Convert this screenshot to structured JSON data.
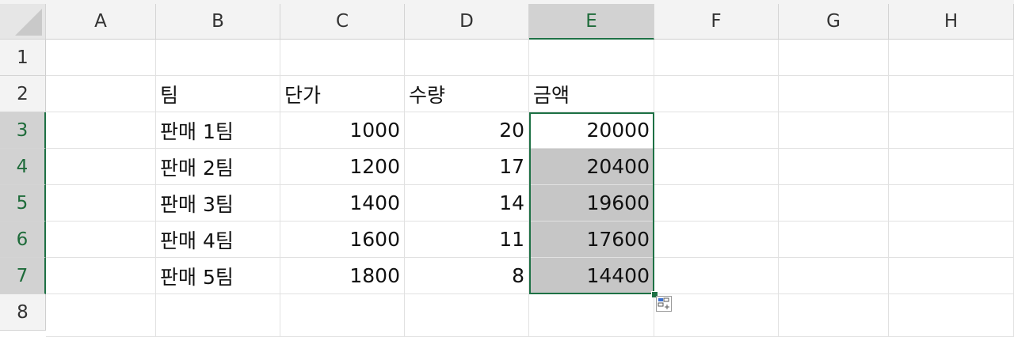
{
  "columns": [
    "A",
    "B",
    "C",
    "D",
    "E",
    "F",
    "G",
    "H"
  ],
  "rows": [
    "1",
    "2",
    "3",
    "4",
    "5",
    "6",
    "7",
    "8"
  ],
  "active_column": "E",
  "headers": {
    "team": "팀",
    "unit_price": "단가",
    "quantity": "수량",
    "amount": "금액"
  },
  "table": [
    {
      "team": "판매 1팀",
      "unit_price": "1000",
      "quantity": "20",
      "amount": "20000"
    },
    {
      "team": "판매 2팀",
      "unit_price": "1200",
      "quantity": "17",
      "amount": "20400"
    },
    {
      "team": "판매 3팀",
      "unit_price": "1400",
      "quantity": "14",
      "amount": "19600"
    },
    {
      "team": "판매 4팀",
      "unit_price": "1600",
      "quantity": "11",
      "amount": "17600"
    },
    {
      "team": "판매 5팀",
      "unit_price": "1800",
      "quantity": "8",
      "amount": "14400"
    }
  ],
  "colors": {
    "selection_border": "#1e7145",
    "selection_fill": "#c6c6c6",
    "header_bg": "#f3f3f3"
  },
  "quick_analysis": {
    "icon": "quick-analysis-icon"
  }
}
